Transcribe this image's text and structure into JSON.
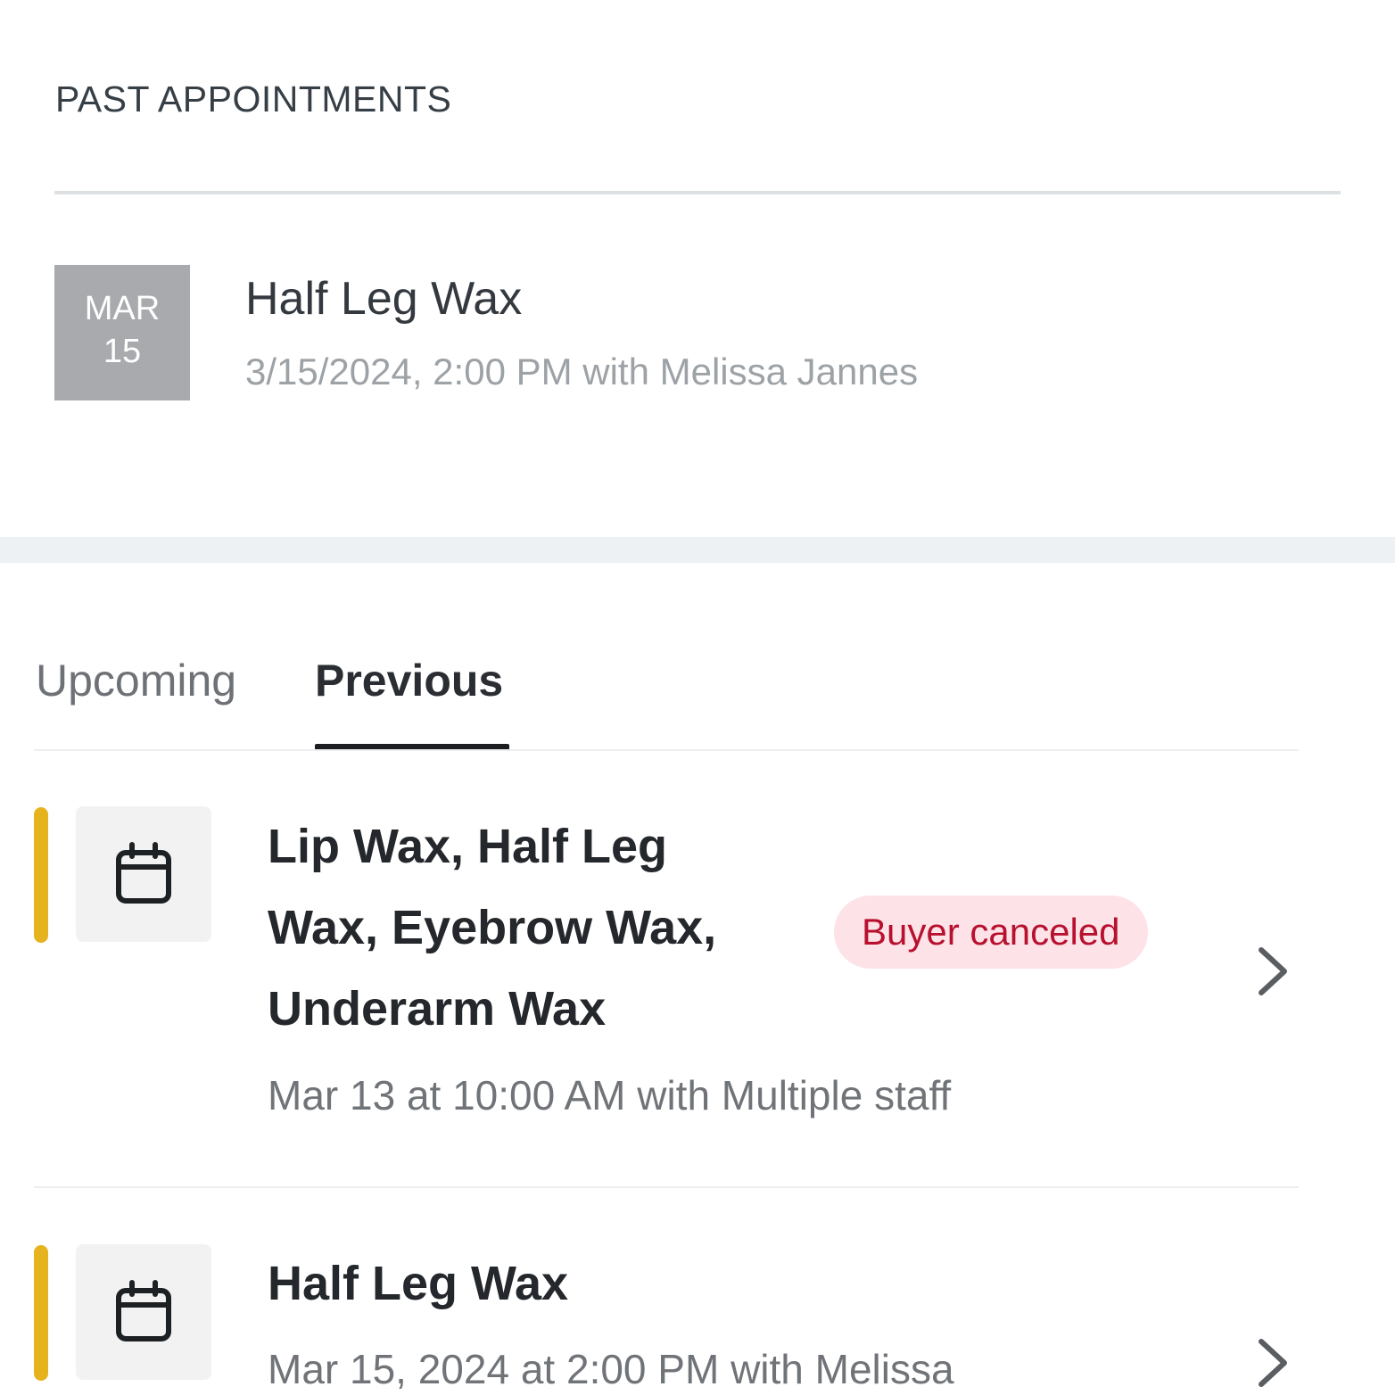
{
  "past_section": {
    "title": "PAST APPOINTMENTS",
    "item": {
      "month": "MAR",
      "day": "15",
      "title": "Half Leg Wax",
      "subtitle": "3/15/2024, 2:00 PM with Melissa Jannes"
    }
  },
  "tabs": {
    "upcoming": "Upcoming",
    "previous": "Previous",
    "active": "previous"
  },
  "appointments": [
    {
      "title_lines": [
        "Lip Wax, Half Leg",
        "Wax, Eyebrow Wax,",
        "Underarm Wax"
      ],
      "subtitle": "Mar 13 at 10:00 AM with Multiple staff",
      "badge": "Buyer canceled",
      "icon": "calendar-icon",
      "accent_color": "#e6b31e"
    },
    {
      "title_lines": [
        "Half Leg Wax"
      ],
      "subtitle": "Mar 15, 2024 at 2:00 PM with Melissa",
      "icon": "calendar-icon",
      "accent_color": "#e6b31e"
    }
  ],
  "colors": {
    "accent": "#e6b31e",
    "badge_bg": "#fde3e7",
    "badge_text": "#b8102f",
    "date_box_bg": "#a9aaad"
  }
}
